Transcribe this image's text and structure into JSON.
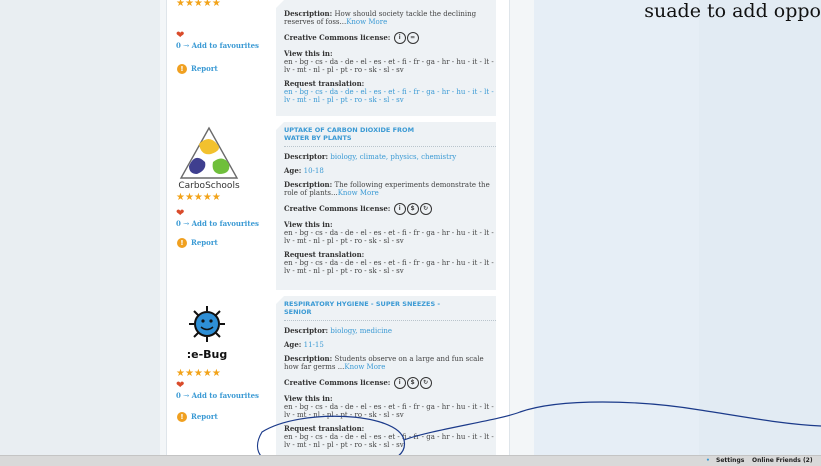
{
  "handwritten_note": "suade to add oppo",
  "card1": {
    "description_label": "Description:",
    "description_text": "How should society tackle the declining reserves of foss...",
    "know_more": "Know More",
    "cc_label": "Creative Commons license:",
    "view_label": "View this in:",
    "view_langs": "en - bg - cs - da - de - el - es - et - fi - fr - ga - hr - hu - it - lt - lv - mt - nl - pl - pt - ro - sk - sl - sv",
    "request_label": "Request translation:",
    "request_langs": "en - bg - cs - da - de - el - es - et - fi - fr - ga - hr - hu - it - lt - lv - mt - nl - pl - pt - ro - sk - sl - sv",
    "fav_count": "0",
    "fav_label": "Add to favourites",
    "report_label": "Report"
  },
  "card2": {
    "title": "UPTAKE OF CARBON DIOXIDE FROM WATER BY PLANTS",
    "logo_text": "CarboSchools",
    "descriptor_label": "Descriptor:",
    "descriptors": "biology, climate, physics, chemistry",
    "age_label": "Age:",
    "age": "10-18",
    "description_label": "Description:",
    "description_text": "The following experiments demonstrate the role of plants...",
    "know_more": "Know More",
    "cc_label": "Creative Commons license:",
    "view_label": "View this in:",
    "view_langs": "en - bg - cs - da - de - el - es - et - fi - fr - ga - hr - hu - it - lt - lv - mt - nl - pl - pt - ro - sk - sl - sv",
    "request_label": "Request translation:",
    "request_langs": "en - bg - cs - da - de - el - es - et - fi - fr - ga - hr - hu - it - lt - lv - mt - nl - pl - pt - ro - sk - sl - sv",
    "fav_count": "0",
    "fav_label": "Add to favourites",
    "report_label": "Report"
  },
  "card3": {
    "title": "RESPIRATORY HYGIENE - SUPER SNEEZES - SENIOR",
    "logo_text": ":e-Bug",
    "descriptor_label": "Descriptor:",
    "descriptors": "biology, medicine",
    "age_label": "Age:",
    "age": "11-15",
    "description_label": "Description:",
    "description_text": "Students observe on a large and fun scale how far germs ...",
    "know_more": "Know More",
    "cc_label": "Creative Commons license:",
    "view_label": "View this in:",
    "view_langs": "en - bg - cs - da - de - el - es - et - fi - fr - ga - hr - hu - it - lt - lv - mt - nl - pl - pt - ro - sk - sl - sv",
    "request_label": "Request translation:",
    "request_langs": "en - bg - cs - da - de - el - es - et - fi - fr - ga - hr - hu - it - lt - lv - mt - nl - pl - pt - ro - sk - sl - sv",
    "fav_count": "0",
    "fav_label": "Add to favourites",
    "report_label": "Report"
  },
  "statusbar": {
    "settings": "Settings",
    "online_friends": "Online Friends (2)"
  },
  "colors": {
    "link": "#3b9ad4",
    "star": "#f2a31a",
    "report": "#f0a020"
  }
}
